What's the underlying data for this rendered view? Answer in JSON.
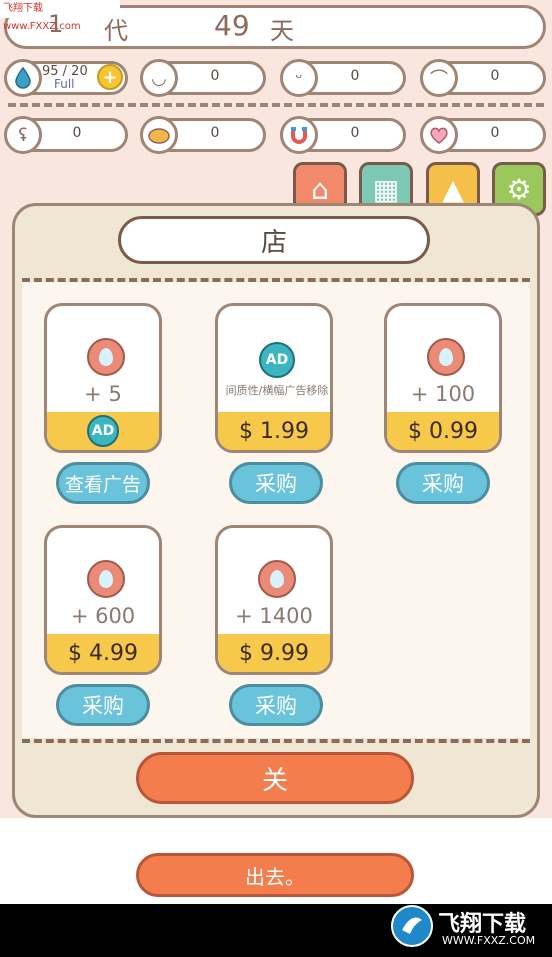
{
  "watermark_top": "飞翔下载 www.FXXZ.com",
  "header": {
    "generation_num": "1",
    "generation_label": "代",
    "days_num": "49",
    "days_label": "天"
  },
  "stats_row1": [
    {
      "icon": "water-drop-icon",
      "value": "95 / 20",
      "sub": "Full",
      "plus": "+"
    },
    {
      "icon": "face-icon",
      "value": "0"
    },
    {
      "icon": "sleep-face-icon",
      "value": "0"
    },
    {
      "icon": "shower-icon",
      "value": "0"
    }
  ],
  "stats_row2": [
    {
      "icon": "muscle-icon",
      "value": "0"
    },
    {
      "icon": "poop-icon",
      "value": "0"
    },
    {
      "icon": "magnet-icon",
      "value": "0"
    },
    {
      "icon": "heart-icon",
      "value": "0"
    }
  ],
  "nav": [
    "home-icon",
    "shop-icon",
    "picture-icon",
    "gear-icon"
  ],
  "shop": {
    "title": "店",
    "items": [
      {
        "amount": "+ 5",
        "price": "AD",
        "button": "查看广告"
      },
      {
        "amount": "间质性/横幅广告移除",
        "price": "$ 1.99",
        "button": "采购",
        "ad_badge": "AD"
      },
      {
        "amount": "+ 100",
        "price": "$ 0.99",
        "button": "采购"
      },
      {
        "amount": "+ 600",
        "price": "$ 4.99",
        "button": "采购"
      },
      {
        "amount": "+ 1400",
        "price": "$ 9.99",
        "button": "采购"
      }
    ],
    "close": "关"
  },
  "exit": "出去。",
  "watermark_bottom": {
    "brand": "飞翔下载",
    "url": "WWW.FXXZ.COM"
  },
  "colors": {
    "accent": "#f47d4e",
    "buy": "#69c3da",
    "price_bg": "#f7c94a",
    "border": "#9e8575"
  }
}
